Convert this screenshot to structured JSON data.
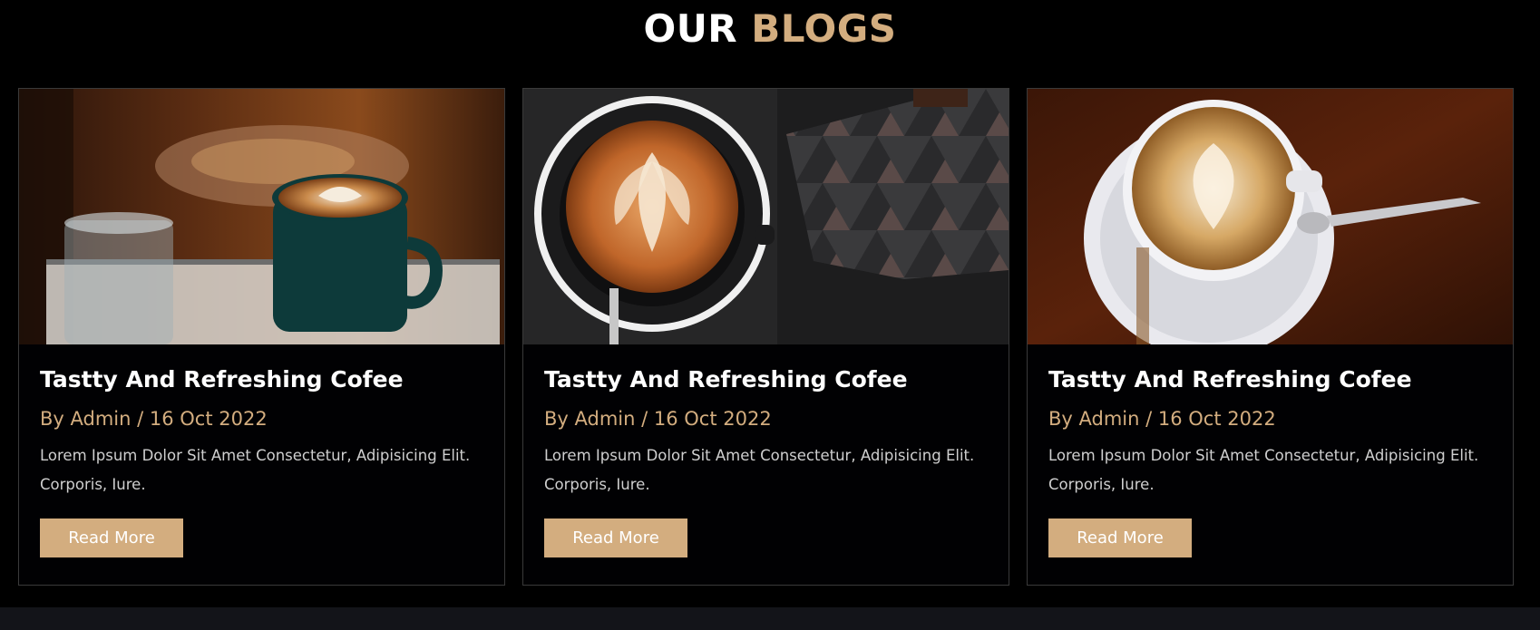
{
  "section": {
    "heading_part1": "OUR",
    "heading_part2": "BLOGS"
  },
  "colors": {
    "accent": "#d3ad7f",
    "background": "#000000",
    "footer": "#131419"
  },
  "blogs": [
    {
      "image": "latte-green-cup-with-glass",
      "title": "Tastty And Refreshing Cofee",
      "meta": "By Admin / 16 Oct 2022",
      "description": "Lorem Ipsum Dolor Sit Amet Consectetur, Adipisicing Elit. Corporis, Iure.",
      "button": "Read More"
    },
    {
      "image": "latte-black-cup-with-wallet",
      "title": "Tastty And Refreshing Cofee",
      "meta": "By Admin / 16 Oct 2022",
      "description": "Lorem Ipsum Dolor Sit Amet Consectetur, Adipisicing Elit. Corporis, Iure.",
      "button": "Read More"
    },
    {
      "image": "latte-white-cup-with-spoon",
      "title": "Tastty And Refreshing Cofee",
      "meta": "By Admin / 16 Oct 2022",
      "description": "Lorem Ipsum Dolor Sit Amet Consectetur, Adipisicing Elit. Corporis, Iure.",
      "button": "Read More"
    }
  ]
}
